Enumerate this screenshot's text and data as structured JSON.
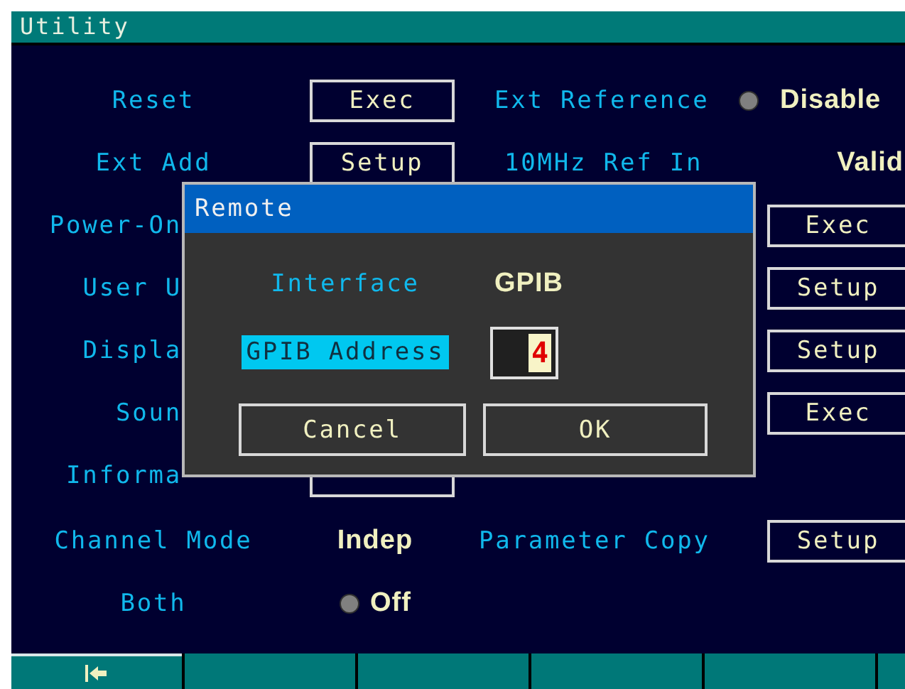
{
  "window": {
    "title": "Utility"
  },
  "rows": [
    {
      "label": "Reset",
      "kind": "button",
      "button": "Exec",
      "right": {
        "kind": "radio",
        "label": "Ext Reference",
        "value": "Disable",
        "on": false
      }
    },
    {
      "label": "Ext Add",
      "kind": "button",
      "button": "Setup",
      "right": {
        "kind": "value",
        "label": "10MHz Ref In",
        "value": "Valid"
      }
    },
    {
      "label": "Power-On",
      "kind": "covered",
      "right": {
        "kind": "button",
        "button": "Exec"
      }
    },
    {
      "label": "User U",
      "kind": "covered",
      "right": {
        "kind": "button",
        "button": "Setup"
      }
    },
    {
      "label": "Displa",
      "kind": "covered",
      "right": {
        "kind": "button",
        "button": "Setup"
      }
    },
    {
      "label": "Soun",
      "kind": "covered",
      "right": {
        "kind": "button",
        "button": "Exec"
      }
    },
    {
      "label": "Informa",
      "kind": "covered-frame"
    }
  ],
  "channel_mode": {
    "label": "Channel Mode",
    "value": "Indep"
  },
  "parameter_copy": {
    "label": "Parameter Copy",
    "button": "Setup"
  },
  "both": {
    "label": "Both",
    "value": "Off",
    "on": false
  },
  "dialog": {
    "title": "Remote",
    "fields": [
      {
        "label": "Interface",
        "value": "GPIB",
        "kind": "text",
        "selected": false
      },
      {
        "label": "GPIB Address",
        "value": "4",
        "kind": "number",
        "selected": true
      }
    ],
    "buttons": [
      "Cancel",
      "OK"
    ]
  },
  "softkeys": [
    {
      "kind": "back"
    },
    {
      "kind": "empty"
    },
    {
      "kind": "empty"
    },
    {
      "kind": "empty"
    },
    {
      "kind": "empty"
    },
    {
      "kind": "empty"
    }
  ]
}
